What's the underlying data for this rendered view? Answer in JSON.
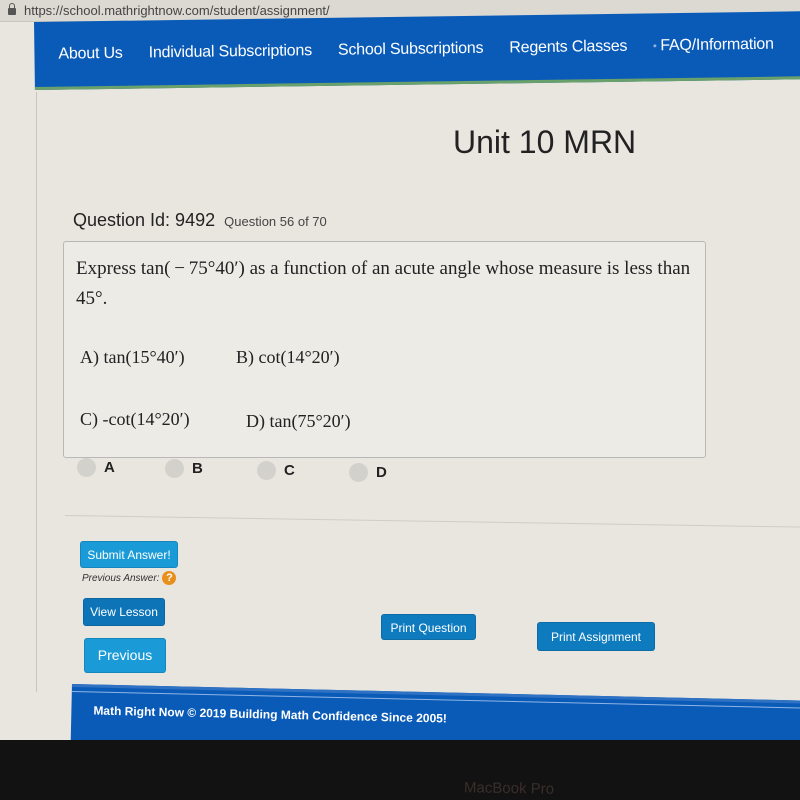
{
  "browser": {
    "url": "https://school.mathrightnow.com/student/assignment/"
  },
  "nav": {
    "items": [
      {
        "label": "About Us"
      },
      {
        "label": "Individual Subscriptions"
      },
      {
        "label": "School Subscriptions"
      },
      {
        "label": "Regents Classes"
      },
      {
        "label": "FAQ/Information"
      }
    ]
  },
  "page": {
    "title": "Unit 10 MRN",
    "question_id_label": "Question Id: 9492",
    "question_progress": "Question 56 of 70"
  },
  "question": {
    "text": "Express tan( − 75°40′) as a function of an acute angle whose measure is less than 45°.",
    "options": {
      "a": "A) tan(15°40′)",
      "b": "B) cot(14°20′)",
      "c": "C) -cot(14°20′)",
      "d": "D) tan(75°20′)"
    },
    "choices": [
      {
        "label": "A",
        "selected": false
      },
      {
        "label": "B",
        "selected": false
      },
      {
        "label": "C",
        "selected": false
      },
      {
        "label": "D",
        "selected": false
      }
    ]
  },
  "actions": {
    "submit": "Submit Answer!",
    "previous_answer": "Previous Answer:",
    "help_icon": "?",
    "view_lesson": "View Lesson",
    "previous": "Previous",
    "print_question": "Print Question",
    "print_assignment": "Print Assignment"
  },
  "footer": {
    "text": "Math Right Now © 2019 Building Math Confidence Since 2005!"
  },
  "device": {
    "label": "MacBook Pro"
  },
  "colors": {
    "nav_blue": "#0a5bb8",
    "button_light": "#1a9ad6",
    "button_dark": "#0d74b8",
    "help_orange": "#e8901c"
  }
}
